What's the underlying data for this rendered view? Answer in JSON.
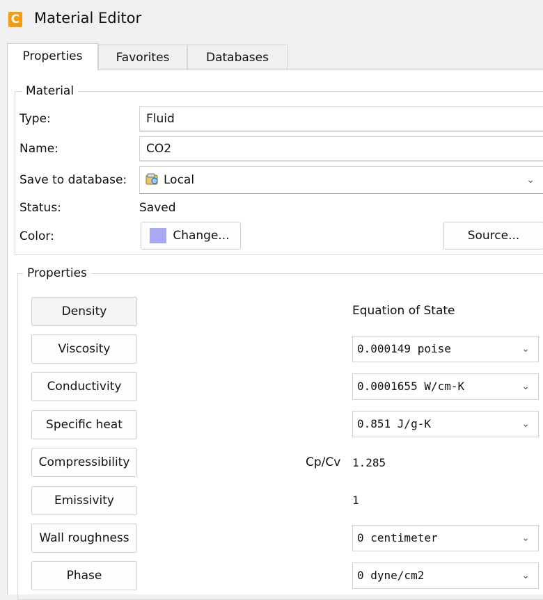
{
  "window": {
    "app_icon_letter": "C",
    "title": "Material Editor",
    "accent_color": "#f39c12"
  },
  "tabs": [
    {
      "label": "Properties",
      "active": true
    },
    {
      "label": "Favorites",
      "active": false
    },
    {
      "label": "Databases",
      "active": false
    }
  ],
  "material": {
    "legend": "Material",
    "type_label": "Type:",
    "type_value": "Fluid",
    "name_label": "Name:",
    "name_value": "CO2",
    "save_label": "Save to database:",
    "save_value": "Local",
    "save_icon": "database-icon",
    "status_label": "Status:",
    "status_value": "Saved",
    "color_label": "Color:",
    "color_swatch": "#a8a8f4",
    "change_button": "Change...",
    "source_button": "Source..."
  },
  "properties": {
    "legend": "Properties",
    "rows": [
      {
        "button": "Density",
        "value": "Equation of State",
        "kind": "text"
      },
      {
        "button": "Viscosity",
        "value": "0.000149 poise",
        "kind": "dropdown"
      },
      {
        "button": "Conductivity",
        "value": "0.0001655 W/cm-K",
        "kind": "dropdown"
      },
      {
        "button": "Specific heat",
        "value": "0.851 J/g-K",
        "kind": "dropdown"
      },
      {
        "button": "Compressibility",
        "prefix": "Cp/Cv",
        "value": "1.285",
        "kind": "text"
      },
      {
        "button": "Emissivity",
        "value": "1",
        "kind": "text"
      },
      {
        "button": "Wall roughness",
        "value": "0 centimeter",
        "kind": "dropdown"
      },
      {
        "button": "Phase",
        "value": "0 dyne/cm2",
        "kind": "dropdown"
      }
    ]
  }
}
